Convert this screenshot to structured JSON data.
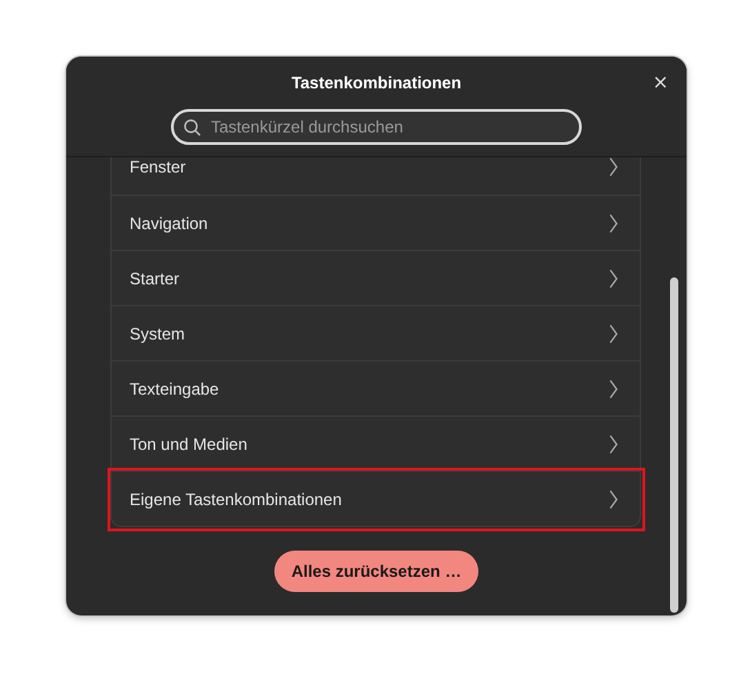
{
  "window": {
    "title": "Tastenkombinationen",
    "close": "×"
  },
  "search": {
    "placeholder": "Tastenkürzel durchsuchen"
  },
  "items": [
    {
      "label": "Fenster",
      "highlighted": false
    },
    {
      "label": "Navigation",
      "highlighted": false
    },
    {
      "label": "Starter",
      "highlighted": false
    },
    {
      "label": "System",
      "highlighted": false
    },
    {
      "label": "Texteingabe",
      "highlighted": false
    },
    {
      "label": "Ton und Medien",
      "highlighted": false
    },
    {
      "label": "Eigene Tastenkombinationen",
      "highlighted": true
    }
  ],
  "reset_button": "Alles zurücksetzen …"
}
